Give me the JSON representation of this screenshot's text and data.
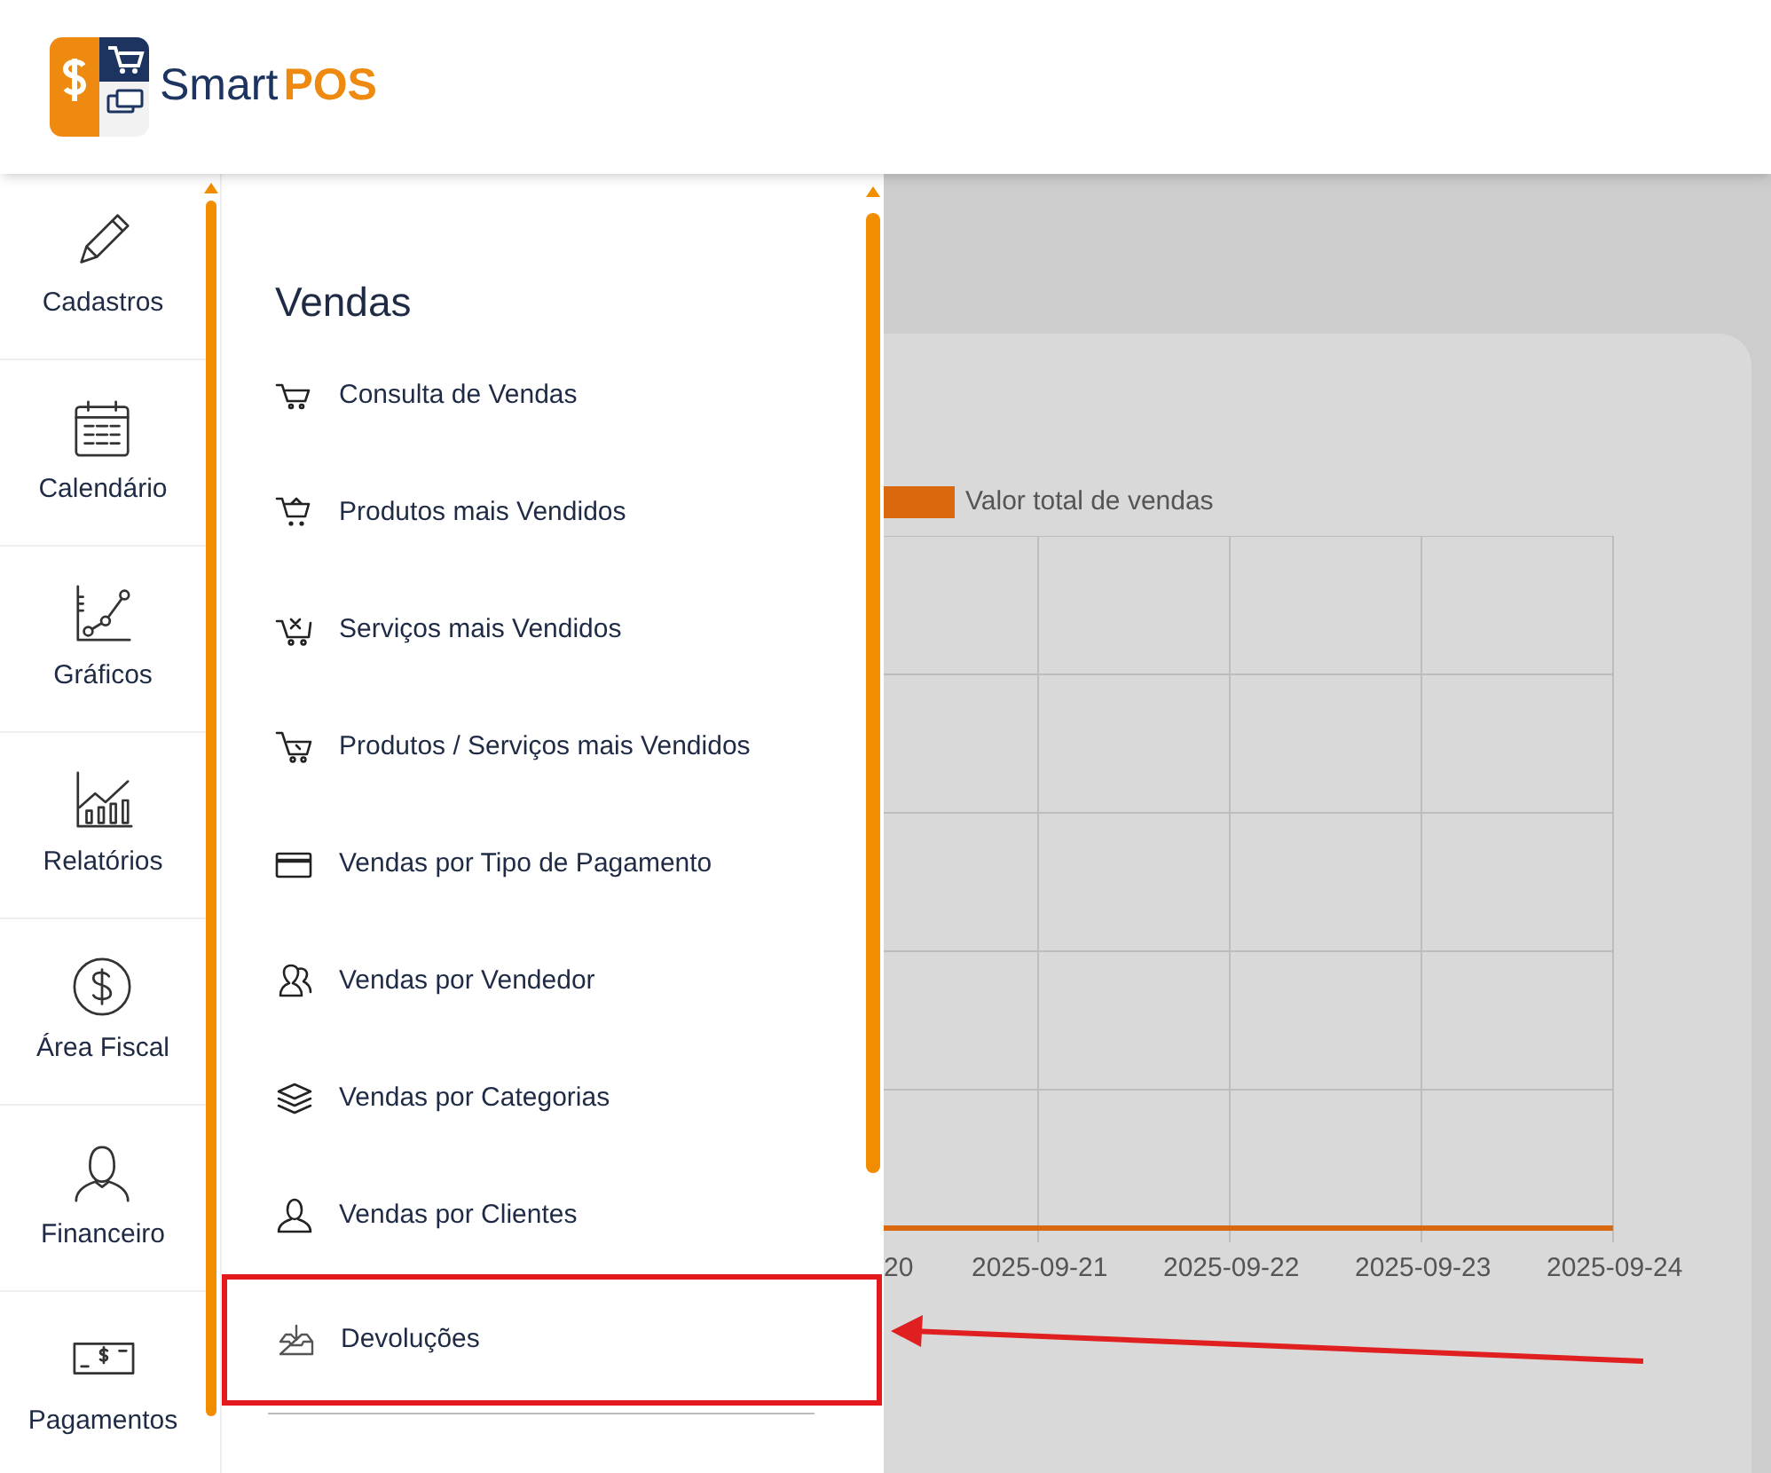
{
  "header": {
    "logo_text": "Smart",
    "logo_accent": "POS"
  },
  "rail": {
    "items": [
      {
        "label": "Cadastros"
      },
      {
        "label": "Calendário"
      },
      {
        "label": "Gráficos"
      },
      {
        "label": "Relatórios"
      },
      {
        "label": "Área Fiscal"
      },
      {
        "label": "Financeiro"
      },
      {
        "label": "Pagamentos"
      }
    ]
  },
  "submenu": {
    "title": "Vendas",
    "items": [
      {
        "label": "Consulta de Vendas",
        "highlighted": false
      },
      {
        "label": "Produtos mais Vendidos",
        "highlighted": false
      },
      {
        "label": "Serviços mais Vendidos",
        "highlighted": false
      },
      {
        "label": "Produtos / Serviços mais Vendidos",
        "highlighted": false
      },
      {
        "label": "Vendas por Tipo de Pagamento",
        "highlighted": false
      },
      {
        "label": "Vendas por Vendedor",
        "highlighted": false
      },
      {
        "label": "Vendas por Categorias",
        "highlighted": false
      },
      {
        "label": "Vendas por Clientes",
        "highlighted": false
      },
      {
        "label": "Devoluções",
        "highlighted": true
      }
    ]
  },
  "chart": {
    "legend": "Valor total de vendas",
    "x_labels": [
      "20",
      "2025-09-21",
      "2025-09-22",
      "2025-09-23",
      "2025-09-24"
    ]
  }
}
